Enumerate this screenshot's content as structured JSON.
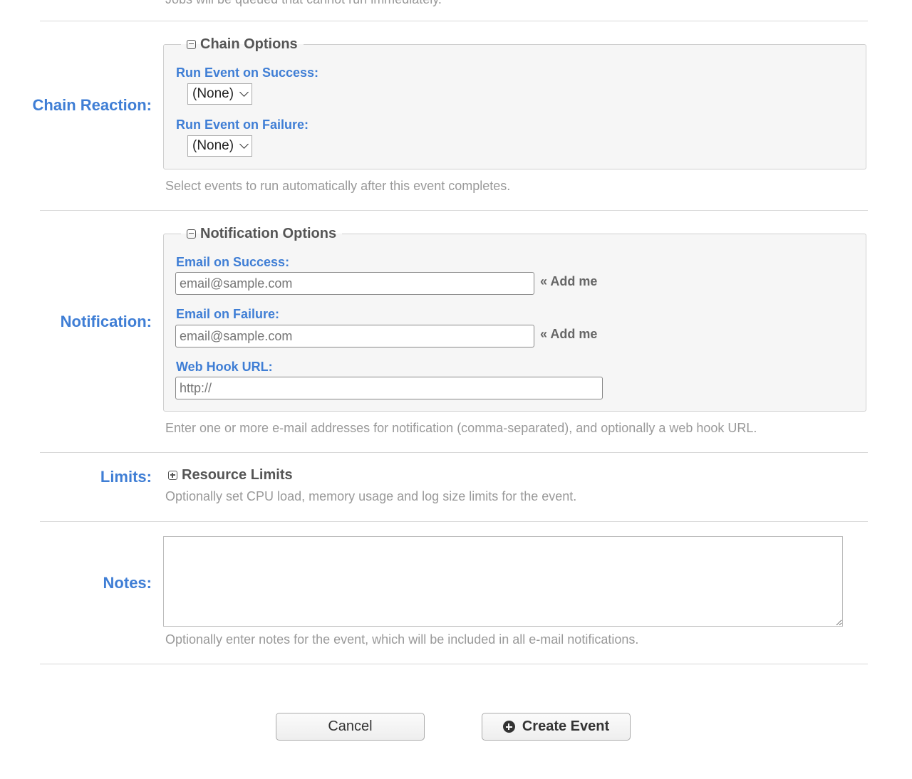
{
  "top_hint": "Jobs will be queued that cannot run immediately.",
  "chain": {
    "label": "Chain Reaction:",
    "legend": "Chain Options",
    "success_label": "Run Event on Success:",
    "success_value": "(None)",
    "failure_label": "Run Event on Failure:",
    "failure_value": "(None)",
    "hint": "Select events to run automatically after this event completes."
  },
  "notification": {
    "label": "Notification:",
    "legend": "Notification Options",
    "email_success_label": "Email on Success:",
    "email_success_placeholder": "email@sample.com",
    "email_failure_label": "Email on Failure:",
    "email_failure_placeholder": "email@sample.com",
    "add_me": "« Add me",
    "webhook_label": "Web Hook URL:",
    "webhook_placeholder": "http://",
    "hint": "Enter one or more e-mail addresses for notification (comma-separated), and optionally a web hook URL."
  },
  "limits": {
    "label": "Limits:",
    "toggle": "Resource Limits",
    "hint": "Optionally set CPU load, memory usage and log size limits for the event."
  },
  "notes": {
    "label": "Notes:",
    "value": "",
    "hint": "Optionally enter notes for the event, which will be included in all e-mail notifications."
  },
  "buttons": {
    "cancel": "Cancel",
    "create": "Create Event"
  },
  "colors": {
    "label_blue": "#3f7ed5",
    "hint_gray": "#999999",
    "panel_bg": "#f6f6f6"
  }
}
